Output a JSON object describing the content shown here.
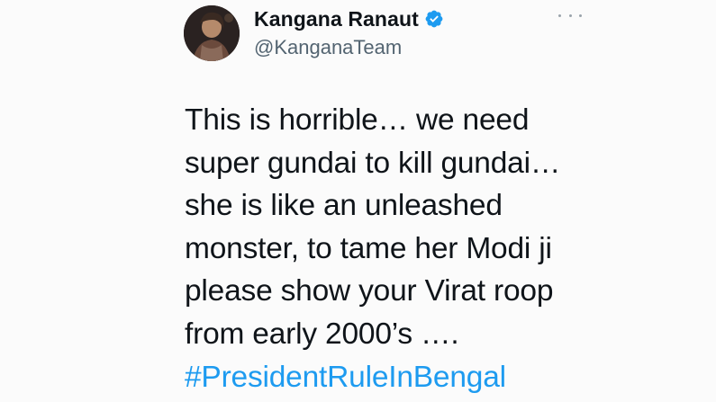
{
  "tweet": {
    "author": {
      "display_name": "Kangana Ranaut",
      "handle": "@KanganaTeam",
      "verified": true,
      "avatar_icon": "avatar-photo"
    },
    "more_icon": "ellipsis-icon",
    "text_lines": [
      "This is horrible… we need",
      "super gundai to kill gundai…",
      "she is like an unleashed",
      "monster, to tame her Modi ji",
      "please show your Virat roop",
      "from early 2000’s …."
    ],
    "hashtag": "#PresidentRuleInBengal"
  },
  "colors": {
    "text": "#0f1419",
    "secondary": "#536471",
    "link": "#1d9bf0",
    "verified": "#1d9bf0"
  }
}
